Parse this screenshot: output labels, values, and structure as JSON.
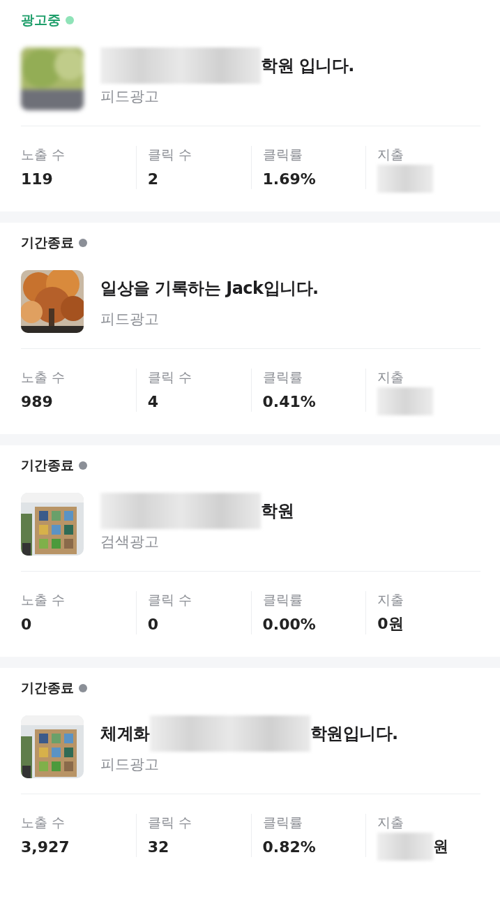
{
  "campaigns": [
    {
      "status": {
        "label": "광고중",
        "kind": "active",
        "color": "#8fe3b8"
      },
      "thumbnail": {
        "kind": "picture"
      },
      "title_segments": [
        {
          "kind": "redacted"
        },
        {
          "kind": "text",
          "text": "학원 입니다."
        }
      ],
      "type": "피드광고",
      "stats": [
        {
          "label": "노출 수",
          "segments": [
            {
              "kind": "text",
              "text": "119"
            }
          ]
        },
        {
          "label": "클릭 수",
          "segments": [
            {
              "kind": "text",
              "text": "2"
            }
          ]
        },
        {
          "label": "클릭률",
          "segments": [
            {
              "kind": "text",
              "text": "1.69%"
            }
          ]
        },
        {
          "label": "지출",
          "segments": [
            {
              "kind": "redacted"
            }
          ]
        }
      ]
    },
    {
      "status": {
        "label": "기간종료",
        "kind": "ended",
        "color": "#8b8f97"
      },
      "thumbnail": {
        "kind": "picture"
      },
      "title_segments": [
        {
          "kind": "text",
          "text": "일상을 기록하는 Jack입니다."
        }
      ],
      "type": "피드광고",
      "stats": [
        {
          "label": "노출 수",
          "segments": [
            {
              "kind": "text",
              "text": "989"
            }
          ]
        },
        {
          "label": "클릭 수",
          "segments": [
            {
              "kind": "text",
              "text": "4"
            }
          ]
        },
        {
          "label": "클릭률",
          "segments": [
            {
              "kind": "text",
              "text": "0.41%"
            }
          ]
        },
        {
          "label": "지출",
          "segments": [
            {
              "kind": "redacted"
            }
          ]
        }
      ]
    },
    {
      "status": {
        "label": "기간종료",
        "kind": "ended",
        "color": "#8b8f97"
      },
      "thumbnail": {
        "kind": "picture"
      },
      "title_segments": [
        {
          "kind": "redacted"
        },
        {
          "kind": "text",
          "text": "학원"
        }
      ],
      "type": "검색광고",
      "stats": [
        {
          "label": "노출 수",
          "segments": [
            {
              "kind": "text",
              "text": "0"
            }
          ]
        },
        {
          "label": "클릭 수",
          "segments": [
            {
              "kind": "text",
              "text": "0"
            }
          ]
        },
        {
          "label": "클릭률",
          "segments": [
            {
              "kind": "text",
              "text": "0.00%"
            }
          ]
        },
        {
          "label": "지출",
          "segments": [
            {
              "kind": "text",
              "text": "0원"
            }
          ]
        }
      ]
    },
    {
      "status": {
        "label": "기간종료",
        "kind": "ended",
        "color": "#8b8f97"
      },
      "thumbnail": {
        "kind": "picture"
      },
      "title_segments": [
        {
          "kind": "text",
          "text": "체계화"
        },
        {
          "kind": "redacted"
        },
        {
          "kind": "text",
          "text": "학원입니다."
        }
      ],
      "type": "피드광고",
      "stats": [
        {
          "label": "노출 수",
          "segments": [
            {
              "kind": "text",
              "text": "3,927"
            }
          ]
        },
        {
          "label": "클릭 수",
          "segments": [
            {
              "kind": "text",
              "text": "32"
            }
          ]
        },
        {
          "label": "클릭률",
          "segments": [
            {
              "kind": "text",
              "text": "0.82%"
            }
          ]
        },
        {
          "label": "지출",
          "segments": [
            {
              "kind": "redacted"
            },
            {
              "kind": "text",
              "text": "원"
            }
          ]
        }
      ]
    }
  ]
}
